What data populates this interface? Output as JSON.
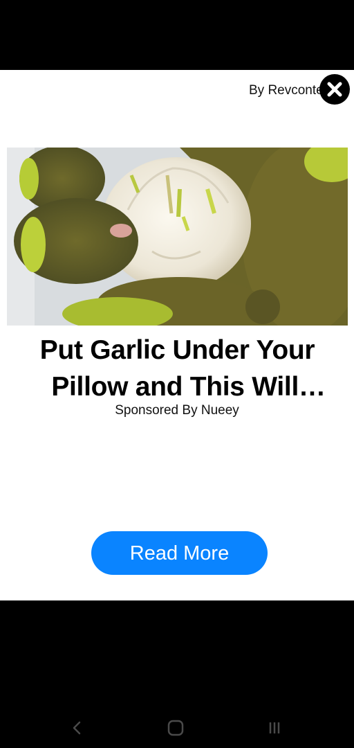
{
  "ad": {
    "attribution": "By Revcontent",
    "close_icon": "close-icon",
    "headline_line1": "Put Garlic Under Your",
    "headline_line2": "Pillow and This Will…",
    "sponsor": "Sponsored By Nueey",
    "cta_label": "Read More",
    "cta_color": "#0a84ff",
    "image_subject": "gloved hands holding a sprouting garlic bulb"
  },
  "navbar": {
    "back_icon": "back-icon",
    "home_icon": "home-icon",
    "recents_icon": "recents-icon"
  }
}
